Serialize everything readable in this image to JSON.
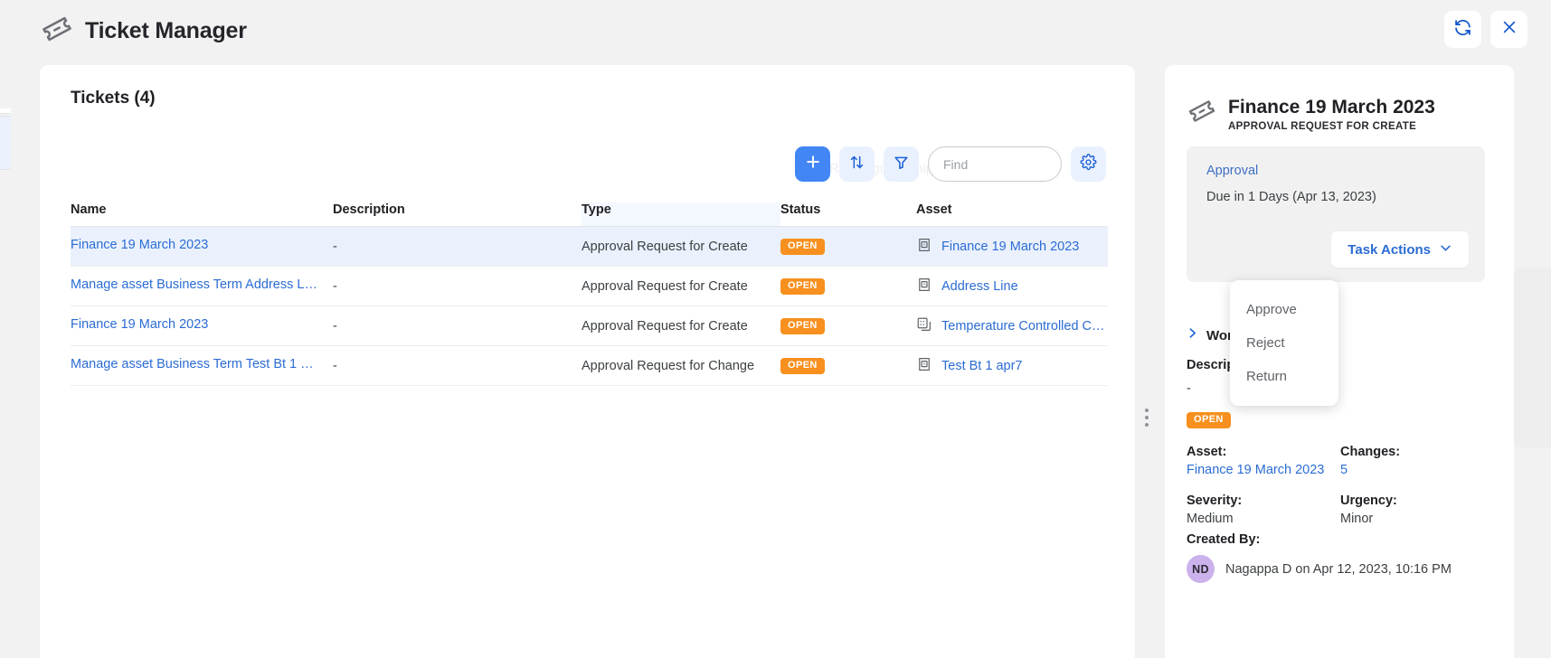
{
  "window": {
    "title": "Ticket Manager",
    "icon": "ticket-icon",
    "refresh_label": "refresh-icon",
    "close_label": "close-icon"
  },
  "watermark": "Rectangular Snip",
  "list": {
    "title": "Tickets (4)",
    "toolbar": {
      "add_label": "+",
      "sort_label": "sort-icon",
      "filter_label": "filter-icon",
      "settings_label": "settings-icon"
    },
    "search": {
      "value": "",
      "placeholder": "Find"
    },
    "columns": [
      "Name",
      "Description",
      "Type",
      "Status",
      "Asset"
    ],
    "rows": [
      {
        "name": "Finance 19 March 2023",
        "description": "-",
        "type": "Approval Request for Create",
        "status": "OPEN",
        "asset": "Finance 19 March 2023",
        "asset_icon": "document-asset-icon",
        "selected": true
      },
      {
        "name": "Manage asset Business Term Address L…",
        "description": "-",
        "type": "Approval Request for Create",
        "status": "OPEN",
        "asset": "Address Line",
        "asset_icon": "document-asset-icon",
        "selected": false
      },
      {
        "name": "Finance 19 March 2023",
        "description": "-",
        "type": "Approval Request for Create",
        "status": "OPEN",
        "asset": "Temperature Controlled Cargo",
        "asset_icon": "dataset-asset-icon",
        "selected": false
      },
      {
        "name": "Manage asset Business Term Test Bt 1 …",
        "description": "-",
        "type": "Approval Request for Change",
        "status": "OPEN",
        "asset": "Test Bt 1 apr7",
        "asset_icon": "document-asset-icon",
        "selected": false
      }
    ]
  },
  "detail": {
    "title": "Finance 19 March 2023",
    "subtitle": "APPROVAL REQUEST FOR CREATE",
    "approval": {
      "label": "Approval",
      "due": "Due in 1 Days (Apr 13, 2023)",
      "actions_button": "Task Actions"
    },
    "dropdown": {
      "items": [
        "Approve",
        "Reject",
        "Return"
      ]
    },
    "workflow_label": "Workflow",
    "description_label": "Description:",
    "description_value": "-",
    "status": "OPEN",
    "fields": {
      "asset_label": "Asset:",
      "asset_value": "Finance 19 March 2023",
      "changes_label": "Changes:",
      "changes_value": "5",
      "severity_label": "Severity:",
      "severity_value": "Medium",
      "urgency_label": "Urgency:",
      "urgency_value": "Minor"
    },
    "created": {
      "label": "Created By:",
      "initials": "ND",
      "text": "Nagappa D on Apr 12, 2023, 10:16 PM"
    }
  },
  "colors": {
    "accent_blue": "#4285f4",
    "link_blue": "#2b6cd4",
    "status_orange": "#f7901e",
    "avatar_purple": "#cbb2ec",
    "selected_row": "#eaf1fd"
  }
}
